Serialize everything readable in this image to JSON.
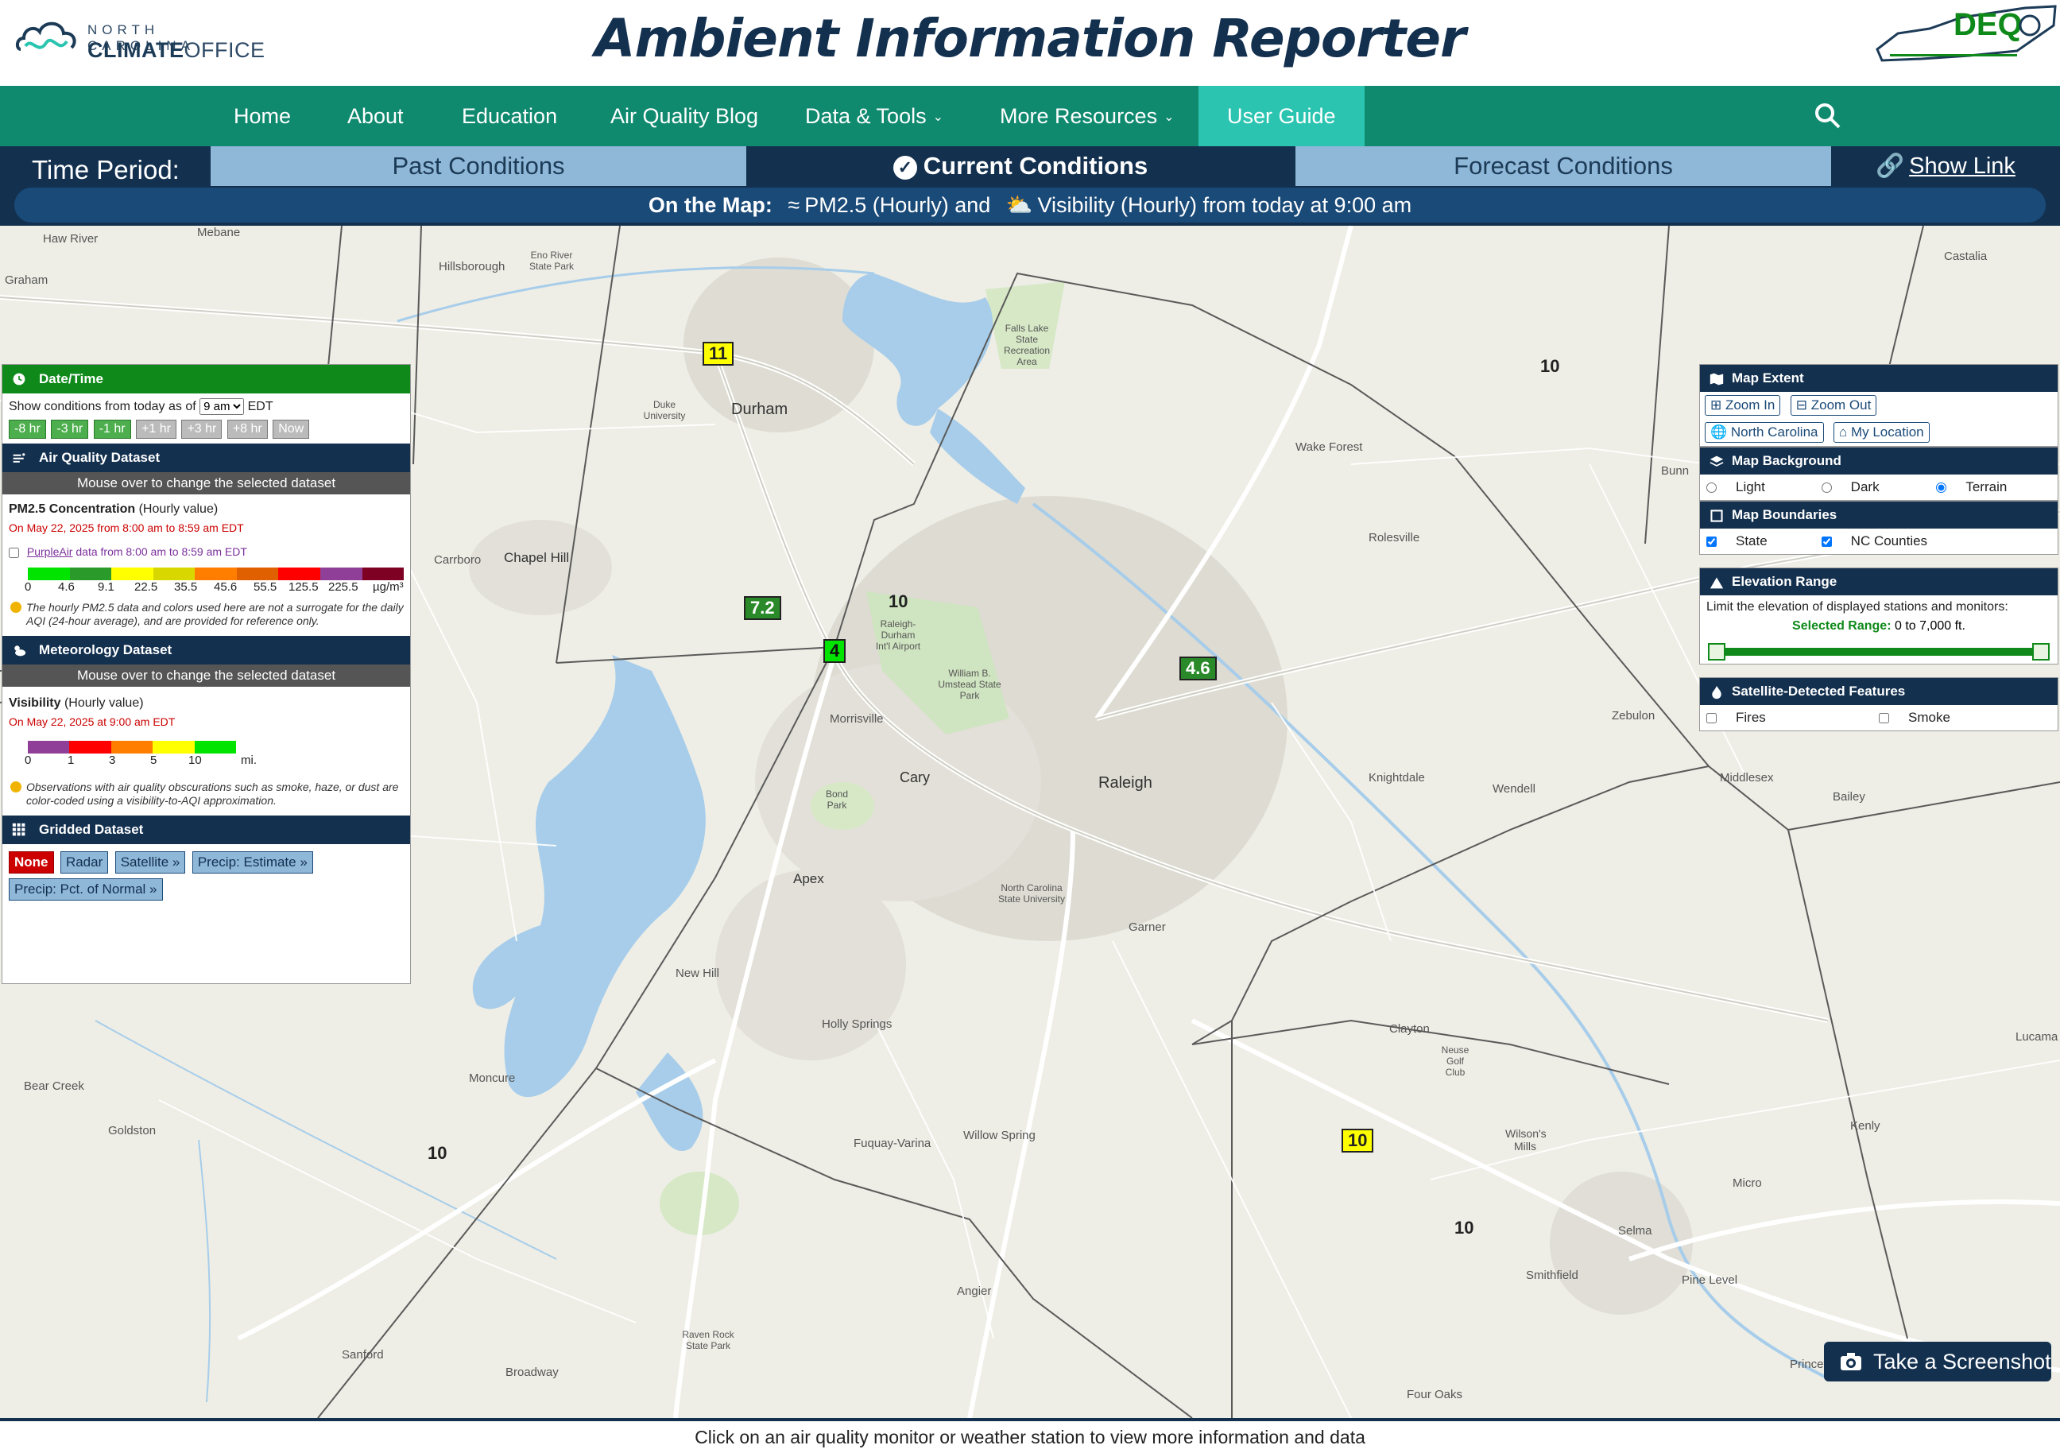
{
  "header": {
    "logo_line1": "NORTH CAROLINA",
    "logo_line2a": "CLIMATE",
    "logo_line2b": "OFFICE",
    "title": "Ambient Information Reporter",
    "deq_text": "DEQ"
  },
  "nav": {
    "items": [
      "Home",
      "About",
      "Education",
      "Air Quality Blog",
      "Data & Tools",
      "More Resources",
      "User Guide"
    ]
  },
  "time_period": {
    "label": "Time Period:",
    "tabs": [
      "Past Conditions",
      "Current Conditions",
      "Forecast Conditions"
    ],
    "active_tab": "Current Conditions",
    "show_link": "Show Link",
    "on_map_label": "On the Map:",
    "on_map_pm": "PM2.5 (Hourly) and",
    "on_map_vis": "Visibility (Hourly) from today at 9:00 am"
  },
  "datetime_panel": {
    "title": "Date/Time",
    "text_before": "Show conditions from today as of",
    "selected_hour": "9 am",
    "text_after": "EDT",
    "buttons": [
      "-8 hr",
      "-3 hr",
      "-1 hr",
      "+1 hr",
      "+3 hr",
      "+8 hr",
      "Now"
    ]
  },
  "aq_panel": {
    "title": "Air Quality Dataset",
    "subbar": "Mouse over to change the selected dataset",
    "name": "PM2.5 Concentration",
    "name_suffix": "(Hourly value)",
    "date": "On May 22, 2025 from 8:00 am to 8:59 am EDT",
    "purpleair_link": "PurpleAir",
    "purpleair_text": "data from 8:00 am to 8:59 am EDT",
    "scale_ticks": [
      "0",
      "4.6",
      "9.1",
      "22.5",
      "35.5",
      "45.6",
      "55.5",
      "125.5",
      "225.5",
      "µg/m³"
    ],
    "note": "The hourly PM2.5 data and colors used here are not a surrogate for the daily AQI (24-hour average), and are provided for reference only."
  },
  "met_panel": {
    "title": "Meteorology Dataset",
    "subbar": "Mouse over to change the selected dataset",
    "name": "Visibility",
    "name_suffix": "(Hourly value)",
    "date": "On May 22, 2025 at 9:00 am EDT",
    "scale_ticks": [
      "0",
      "1",
      "3",
      "5",
      "10",
      "mi."
    ],
    "note": "Observations with air quality obscurations such as smoke, haze, or dust are color-coded using a visibility-to-AQI approximation."
  },
  "grid_panel": {
    "title": "Gridded Dataset",
    "buttons": [
      "None",
      "Radar",
      "Satellite »",
      "Precip: Estimate »",
      "Precip: Pct. of Normal »"
    ],
    "selected": "None"
  },
  "map_extent": {
    "title": "Map Extent",
    "buttons": [
      "Zoom In",
      "Zoom Out",
      "North Carolina",
      "My Location"
    ]
  },
  "map_background": {
    "title": "Map Background",
    "options": [
      "Light",
      "Dark",
      "Terrain"
    ],
    "selected": "Terrain"
  },
  "map_boundaries": {
    "title": "Map Boundaries",
    "options": [
      "State",
      "NC Counties"
    ]
  },
  "elevation": {
    "title": "Elevation Range",
    "text": "Limit the elevation of displayed stations and monitors:",
    "selected_label": "Selected Range:",
    "selected_value": "0 to 7,000 ft."
  },
  "satellite": {
    "title": "Satellite-Detected Features",
    "options": [
      "Fires",
      "Smoke"
    ]
  },
  "map": {
    "towns_big": [
      "Durham",
      "Chapel Hill",
      "Cary",
      "Raleigh",
      "Apex"
    ],
    "towns": [
      "Haw River",
      "Mebane",
      "Graham",
      "Hillsborough",
      "Eno River State Park",
      "Duke University",
      "Falls Lake State Recreation Area",
      "Wake Forest",
      "Carrboro",
      "Rolesville",
      "Morrisville",
      "Knightdale",
      "Wendell",
      "Zebulon",
      "Bond Park",
      "North Carolina State University",
      "Garner",
      "New Hill",
      "Holly Springs",
      "Clayton",
      "Moncure",
      "Fuquay-Varina",
      "Willow Spring",
      "Bear Creek",
      "Goldston",
      "Smithfield",
      "Selma",
      "Angier",
      "Sanford",
      "Broadway",
      "Raven Rock State Park",
      "Pine Level",
      "Princeton",
      "Middlesex",
      "Bailey",
      "Castalia",
      "Bunn",
      "Micro",
      "Kenly",
      "Lucama",
      "Wilson's Mills",
      "Neuse Golf Club",
      "Four Oaks",
      "William B. Umstead State Park",
      "Raleigh-Durham Int'l Airport"
    ],
    "pm_markers": [
      {
        "value": "11",
        "color": "yellow"
      },
      {
        "value": "7.2",
        "color": "dgreen"
      },
      {
        "value": "4",
        "color": "green"
      },
      {
        "value": "4.6",
        "color": "dgreen"
      },
      {
        "value": "10",
        "color": "yellow"
      }
    ],
    "vis_labels": [
      "10",
      "10",
      "10",
      "10"
    ]
  },
  "screenshot_button": "Take a Screenshot",
  "footer": "Click on an air quality monitor or weather station to view more information and data"
}
